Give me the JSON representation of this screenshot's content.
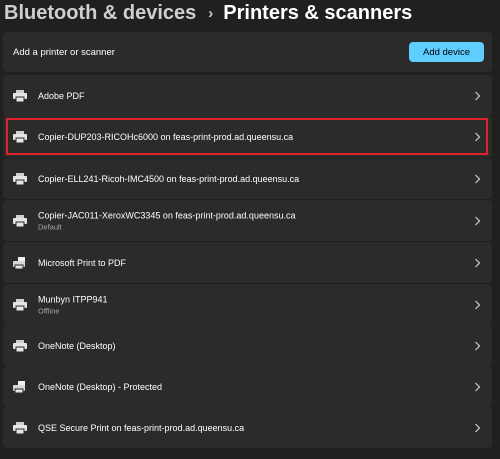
{
  "breadcrumb": {
    "parent": "Bluetooth & devices",
    "separator": "›",
    "current": "Printers & scanners"
  },
  "add_section": {
    "label": "Add a printer or scanner",
    "button_label": "Add device"
  },
  "devices": [
    {
      "name": "Adobe PDF",
      "status": "",
      "icon": "printer-icon"
    },
    {
      "name": "Copier-DUP203-RICOHc6000 on feas-print-prod.ad.queensu.ca",
      "status": "",
      "icon": "printer-icon",
      "highlighted": true
    },
    {
      "name": "Copier-ELL241-Ricoh-IMC4500 on feas-print-prod.ad.queensu.ca",
      "status": "",
      "icon": "printer-icon"
    },
    {
      "name": "Copier-JAC011-XeroxWC3345 on feas-print-prod.ad.queensu.ca",
      "status": "Default",
      "icon": "printer-icon"
    },
    {
      "name": "Microsoft Print to PDF",
      "status": "",
      "icon": "printer-document-icon"
    },
    {
      "name": "Munbyn ITPP941",
      "status": "Offline",
      "icon": "printer-icon"
    },
    {
      "name": "OneNote (Desktop)",
      "status": "",
      "icon": "printer-icon"
    },
    {
      "name": "OneNote (Desktop) - Protected",
      "status": "",
      "icon": "printer-document-icon"
    },
    {
      "name": "QSE Secure Print on feas-print-prod.ad.queensu.ca",
      "status": "",
      "icon": "printer-icon"
    }
  ],
  "colors": {
    "background": "#202020",
    "card": "#2b2b2b",
    "accent": "#60cdff",
    "highlight_border": "#e0232b"
  }
}
